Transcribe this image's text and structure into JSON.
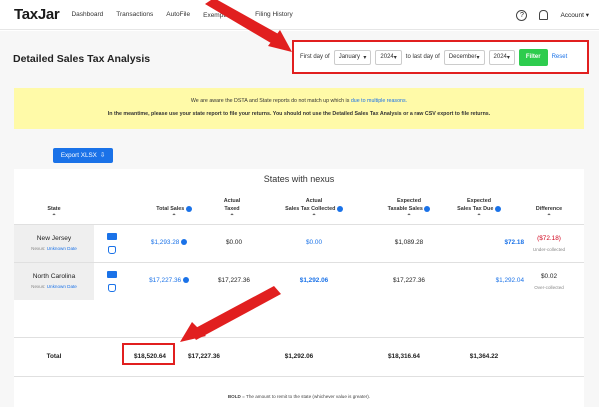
{
  "nav": {
    "logo": "TaxJar",
    "items": [
      "Dashboard",
      "Transactions",
      "AutoFile",
      "Exemptions ▾",
      "Filing History"
    ],
    "account": "Account ▾"
  },
  "page": {
    "title": "Detailed Sales Tax Analysis"
  },
  "filter": {
    "first_label": "First day of",
    "from_month": "January",
    "from_year": "2024",
    "to_label": "to last day of",
    "to_month": "December",
    "to_year": "2024",
    "filter_label": "Filter",
    "reset_label": "Reset"
  },
  "notice": {
    "line1_prefix": "We are aware the DSTA and State reports do not match up which is ",
    "line1_link": "due to multiple reasons.",
    "line2": "In the meantime, please use your state report to file your returns. You should not use the Detailed Sales Tax Analysis or a raw CSV export to file returns."
  },
  "export": {
    "label": "Export XLSX"
  },
  "table": {
    "title": "States with nexus",
    "headers": {
      "state": "State",
      "total_sales": "Total Sales",
      "taxed_1": "Actual",
      "taxed_2": "Taxed",
      "collected_1": "Actual",
      "collected_2": "Sales Tax Collected",
      "taxable_1": "Expected",
      "taxable_2": "Taxable Sales",
      "due_1": "Expected",
      "due_2": "Sales Tax Due",
      "difference": "Difference"
    },
    "rows": [
      {
        "state": "New Jersey",
        "nexus_label": "Nexus:",
        "nexus_date": "Unknown Date",
        "total_sales": "$1,293.28",
        "taxed": "$0.00",
        "collected": "$0.00",
        "taxable": "$1,089.28",
        "due": "$72.18",
        "difference": "($72.18)",
        "difference_note": "Under-collected"
      },
      {
        "state": "North Carolina",
        "nexus_label": "Nexus:",
        "nexus_date": "Unknown Date",
        "total_sales": "$17,227.36",
        "taxed": "$17,227.36",
        "collected": "$1,292.06",
        "taxable": "$17,227.36",
        "due": "$1,292.04",
        "difference": "$0.02",
        "difference_note": "Over-collected"
      }
    ],
    "total": {
      "label": "Total",
      "total_sales": "$18,520.64",
      "taxed": "$17,227.36",
      "collected": "$1,292.06",
      "taxable": "$18,316.64",
      "due": "$1,364.22"
    },
    "footnote_bold": "BOLD",
    "footnote_rest": " = The amount to remit to the state (whichever value is greater)."
  },
  "colors": {
    "accent": "#1a72e8",
    "annotation": "#e11f1f",
    "filter_button": "#2dcc4e",
    "notice_bg": "#fffaa8"
  }
}
